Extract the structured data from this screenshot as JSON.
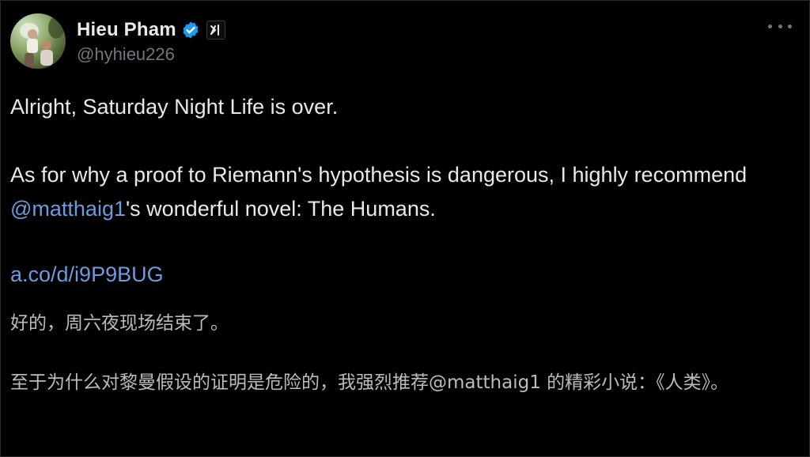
{
  "author": {
    "display_name": "Hieu Pham",
    "handle": "@hyhieu226",
    "verified_icon": "verified-badge-icon",
    "affiliation_badge": "xаг"
  },
  "colors": {
    "background": "#000000",
    "text": "#e7e9ea",
    "muted": "#71767b",
    "link": "#6b9be0",
    "verified": "#1d9bf0"
  },
  "tweet": {
    "line1": "Alright, Saturday Night Life is over.",
    "para2_a": "As for why a proof to Riemann's hypothesis is dangerous, I highly recommend ",
    "mention": "@matthaig1",
    "para2_b": "'s wonderful novel: The Humans.",
    "url": "a.co/d/i9P9BUG"
  },
  "translation": {
    "line1": "好的，周六夜现场结束了。",
    "line2": "至于为什么对黎曼假设的证明是危险的，我强烈推荐@matthaig1 的精彩小说：《人类》。"
  }
}
